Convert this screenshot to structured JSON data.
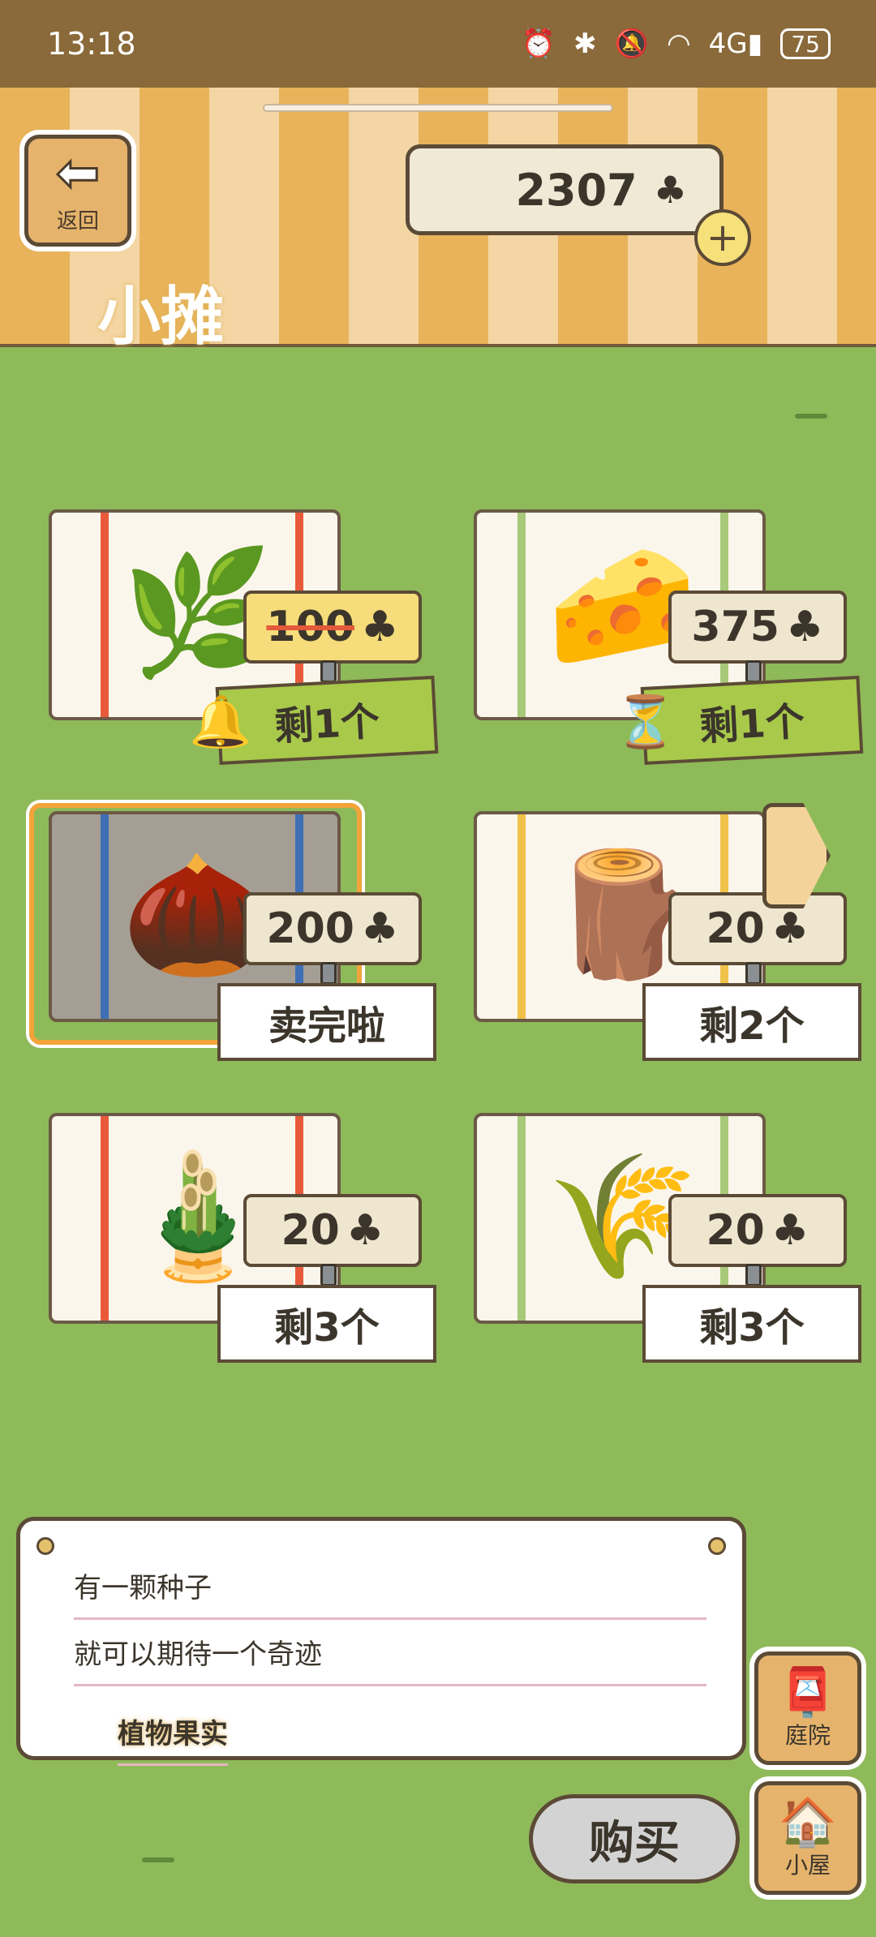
{
  "status": {
    "time": "13:18",
    "icons": [
      "alarm-icon",
      "bluetooth-icon",
      "mute-icon",
      "wifi-icon",
      "signal-4g-icon"
    ],
    "network": "4G",
    "battery": "75"
  },
  "header": {
    "back_label": "返回",
    "coins": "2307",
    "title": "小摊"
  },
  "items": [
    {
      "price": "100",
      "price_strike": true,
      "stock": "剩1个",
      "stock_style": "green",
      "badge": "bell-icon",
      "art": "herb"
    },
    {
      "price": "375",
      "price_strike": false,
      "stock": "剩1个",
      "stock_style": "green",
      "badge": "hourglass-icon",
      "art": "cheese"
    },
    {
      "price": "200",
      "price_strike": false,
      "stock": "卖完啦",
      "stock_style": "white",
      "art": "pinecone",
      "selected": true
    },
    {
      "price": "20",
      "price_strike": false,
      "stock": "剩2个",
      "stock_style": "white",
      "art": "log"
    },
    {
      "price": "20",
      "price_strike": false,
      "stock": "剩3个",
      "stock_style": "white",
      "art": "bamboo"
    },
    {
      "price": "20",
      "price_strike": false,
      "stock": "剩3个",
      "stock_style": "white",
      "art": "straw"
    }
  ],
  "description": {
    "lines": [
      "植物果实",
      "有一颗种子",
      "就可以期待一个奇迹"
    ]
  },
  "side_buttons": {
    "yard_label": "庭院",
    "house_label": "小屋"
  },
  "buy_label": "购买",
  "colors": {
    "grass": "#8fba5a",
    "stripe_orange": "#e8b35a",
    "selected_border": "#f2a43a",
    "stock_green": "#a8c94a"
  }
}
